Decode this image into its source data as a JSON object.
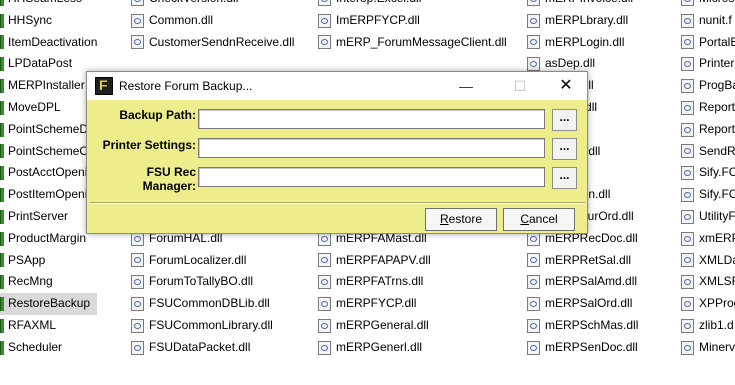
{
  "explorer": {
    "col1": [
      "HHSeamLess",
      "HHSync",
      "ItemDeactivation",
      "LPDataPost",
      "MERPInstaller",
      "MoveDPL",
      "PointSchemeD",
      "PointSchemeO",
      "PostAcctOpeni",
      "PostItemOpeni",
      "PrintServer",
      "ProductMargin",
      "PSApp",
      "RecMng",
      "RestoreBackup",
      "RFAXML",
      "Scheduler"
    ],
    "col1_selected": "RestoreBackup",
    "col2": [
      "CheckVersion.dll",
      "Common.dll",
      "CustomerSendnReceive.dll",
      "",
      "",
      "",
      "",
      "",
      "",
      "",
      "ForumEngine.dll",
      "ForumHAL.dll",
      "ForumLocalizer.dll",
      "ForumToTallyBO.dll",
      "FSUCommonDBLib.dll",
      "FSUCommonLibrary.dll",
      "FSUDataPacket.dll"
    ],
    "col3": [
      "Interop.Excel.dll",
      "ImERPFYCP.dll",
      "mERP_ForumMessageClient.dll",
      "",
      "",
      "",
      "",
      "",
      "",
      "",
      "mERPFACARV.dll",
      "mERPFAMast.dll",
      "mERPFAPAPV.dll",
      "mERPFATrns.dll",
      "mERPFYCP.dll",
      "mERPGeneral.dll",
      "mERPGenerl.dll"
    ],
    "col4": [
      "mERPInvoice.dll",
      "mERPLbrary.dll",
      "mERPLogin.dll",
      "asDep.dll",
      "onImp.dll",
      "herOpt.dll",
      "rMas.dll",
      "rfMetric.dll",
      "nOpt.dll",
      "odMargin.dll",
      "mERPPurOrd.dll",
      "mERPRecDoc.dll",
      "mERPRetSal.dll",
      "mERPSalAmd.dll",
      "mERPSalOrd.dll",
      "mERPSchMas.dll",
      "mERPSenDoc.dll"
    ],
    "col5": [
      "Micros",
      "nunit.f",
      "PortalB",
      "Printer",
      "ProgBa",
      "Report",
      "Report",
      "SendRe",
      "Sify.FC",
      "Sify.FC",
      "UtilityF",
      "xmERP",
      "XMLDa",
      "XMLSR",
      "XPProg",
      "zlib1.d",
      "Minerv"
    ]
  },
  "dialog": {
    "title": "Restore Forum Backup...",
    "minimize": "—",
    "maximize": "☐",
    "close": "✕",
    "fields": [
      {
        "label": "Backup Path:",
        "value": "",
        "browse": "..."
      },
      {
        "label": "Printer Settings:",
        "value": "",
        "browse": "..."
      },
      {
        "label": "FSU Rec Manager:",
        "value": "",
        "browse": "..."
      }
    ],
    "restore_first": "R",
    "restore_rest": "estore",
    "cancel_first": "C",
    "cancel_rest": "ancel"
  }
}
